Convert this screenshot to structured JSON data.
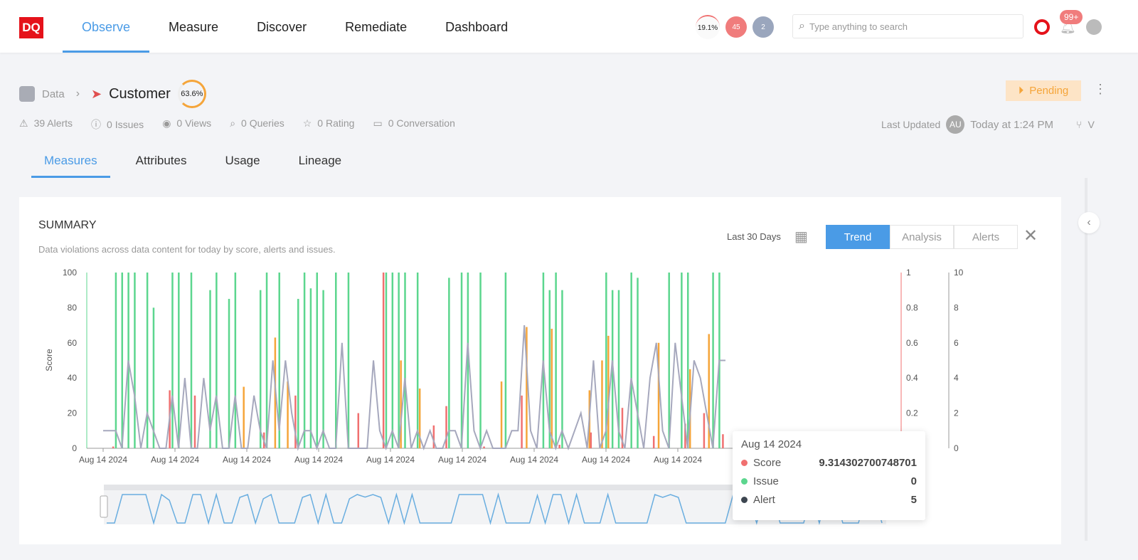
{
  "header": {
    "logo": "DQ",
    "nav": [
      "Observe",
      "Measure",
      "Discover",
      "Remediate",
      "Dashboard"
    ],
    "active_nav": "Observe",
    "score_ring": "19.1%",
    "badge_red": "45",
    "badge_gray": "2",
    "search_placeholder": "Type anything to search",
    "notifications": "99+"
  },
  "breadcrumb": {
    "root": "Data",
    "title": "Customer",
    "score": "63.6%"
  },
  "status": {
    "label": "Pending",
    "color": "#f5a623"
  },
  "meta": {
    "alerts": "39 Alerts",
    "issues": "0 Issues",
    "views": "0 Views",
    "queries": "0 Queries",
    "rating": "0 Rating",
    "conversation": "0 Conversation",
    "last_updated_label": "Last Updated",
    "avatar": "AU",
    "last_updated": "Today at 1:24 PM",
    "version": "V"
  },
  "tabs": [
    "Measures",
    "Attributes",
    "Usage",
    "Lineage"
  ],
  "summary": {
    "title": "SUMMARY",
    "subtitle": "Data violations across data content for today by score, alerts and issues.",
    "range": "Last 30 Days",
    "views": [
      "Trend",
      "Analysis",
      "Alerts"
    ],
    "active_view": "Trend"
  },
  "tooltip": {
    "date": "Aug 14 2024",
    "rows": [
      {
        "label": "Score",
        "value": "9.314302700748701",
        "color": "#f07070"
      },
      {
        "label": "Issue",
        "value": "0",
        "color": "#5cd68e"
      },
      {
        "label": "Alert",
        "value": "5",
        "color": "#3d4650"
      }
    ]
  },
  "chart_data": {
    "type": "bar",
    "ylabel": "Score",
    "ylim": [
      0,
      100
    ],
    "y_ticks": [
      "0",
      "20",
      "40",
      "60",
      "80",
      "100"
    ],
    "y2_ticks": [
      "0",
      "0.2",
      "0.4",
      "0.6",
      "0.8",
      "1"
    ],
    "y3_ticks": [
      "0",
      "2",
      "4",
      "6",
      "8",
      "10"
    ],
    "x_ticks": [
      "Aug 14 2024",
      "Aug 14 2024",
      "Aug 14 2024",
      "Aug 14 2024",
      "Aug 14 2024",
      "Aug 14 2024",
      "Aug 14 2024",
      "Aug 14 2024",
      "Aug 14 2024"
    ],
    "colors": {
      "issue": "#5cd68e",
      "score": "#f07070",
      "orange": "#f5a53a",
      "alert": "#a6a8bd",
      "navigator": "#6aaee0"
    },
    "issue": [
      0,
      0,
      100,
      100,
      100,
      100,
      0,
      100,
      80,
      0,
      0,
      100,
      100,
      0,
      100,
      0,
      0,
      90,
      100,
      0,
      85,
      100,
      0,
      0,
      0,
      90,
      100,
      0,
      100,
      0,
      0,
      85,
      100,
      91,
      100,
      90,
      0,
      100,
      0,
      100,
      0,
      0,
      0,
      0,
      0,
      100,
      100,
      100,
      100,
      0,
      100,
      0,
      0,
      0,
      0,
      97,
      0,
      100,
      100,
      0,
      100,
      0,
      0,
      0,
      100,
      0,
      0,
      0,
      0,
      0,
      100,
      90,
      100,
      90,
      0,
      0,
      0,
      0,
      0,
      0,
      100,
      90,
      90,
      0,
      100,
      97,
      0,
      0,
      0,
      0,
      100,
      0,
      100,
      100,
      0,
      0,
      0,
      100,
      100,
      0
    ],
    "score": [
      0,
      1,
      0,
      0,
      0,
      0,
      0,
      0,
      0,
      0,
      33,
      0,
      0,
      0,
      30,
      0,
      0,
      0,
      0,
      0,
      0,
      0,
      0,
      0,
      0,
      9,
      0,
      0,
      0,
      0,
      30,
      0,
      0,
      0,
      0,
      0,
      0,
      0,
      0,
      0,
      20,
      0,
      0,
      0,
      100,
      0,
      0,
      0,
      0,
      0,
      0,
      0,
      13,
      0,
      24,
      0,
      0,
      0,
      0,
      0,
      1,
      0,
      0,
      0,
      0,
      0,
      30,
      0,
      0,
      0,
      0,
      0,
      2,
      0,
      0,
      0,
      0,
      9,
      0,
      0,
      0,
      0,
      23,
      0,
      0,
      0,
      0,
      7,
      0,
      0,
      0,
      0,
      14,
      0,
      0,
      20,
      0,
      0,
      8,
      0
    ],
    "orange": [
      0,
      0,
      0,
      0,
      0,
      0,
      0,
      0,
      0,
      0,
      0,
      0,
      0,
      0,
      0,
      0,
      0,
      0,
      0,
      0,
      0,
      0,
      35,
      0,
      0,
      0,
      0,
      63,
      0,
      38,
      0,
      0,
      0,
      0,
      0,
      0,
      0,
      0,
      0,
      0,
      0,
      0,
      0,
      0,
      0,
      0,
      0,
      50,
      0,
      0,
      34,
      0,
      0,
      0,
      0,
      0,
      0,
      0,
      0,
      0,
      0,
      0,
      0,
      38,
      0,
      0,
      0,
      69,
      0,
      0,
      0,
      68,
      0,
      0,
      0,
      0,
      0,
      33,
      0,
      50,
      64,
      0,
      0,
      0,
      0,
      0,
      0,
      0,
      60,
      0,
      0,
      0,
      0,
      45,
      0,
      0,
      65,
      0,
      0,
      0
    ],
    "alert": [
      1,
      1,
      1,
      0,
      5,
      3,
      0,
      2,
      1,
      0,
      0,
      3,
      0,
      4,
      0,
      0,
      4,
      1,
      3,
      0,
      0,
      3,
      0,
      0,
      3,
      1,
      0,
      5,
      1,
      5,
      2,
      0,
      1,
      1,
      0,
      1,
      0,
      0,
      6,
      0,
      0,
      0,
      0,
      5,
      1,
      0,
      1,
      0,
      4,
      0,
      1,
      0,
      1,
      0,
      0,
      1,
      1,
      0,
      6,
      1,
      0,
      1,
      0,
      0,
      0,
      1,
      1,
      7,
      1,
      0,
      5,
      1,
      0,
      1,
      0,
      1,
      2,
      0,
      5,
      0,
      1,
      5,
      1,
      0,
      4,
      2,
      0,
      4,
      6,
      1,
      0,
      6,
      3,
      0,
      5,
      4,
      2,
      0,
      5,
      5
    ]
  }
}
